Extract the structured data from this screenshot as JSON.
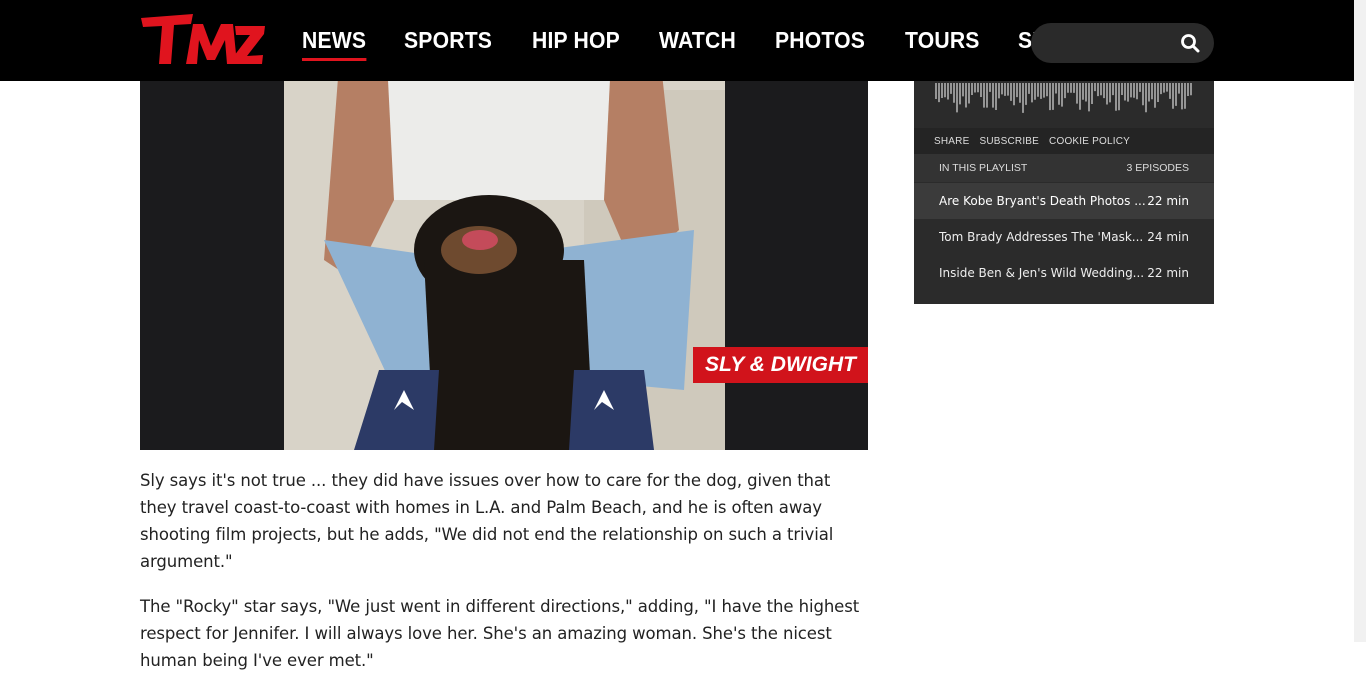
{
  "brand": {
    "logo_text": "TMZ",
    "accent": "#e0141e"
  },
  "nav": {
    "items": [
      {
        "label": "NEWS",
        "active": true
      },
      {
        "label": "SPORTS",
        "active": false
      },
      {
        "label": "HIP HOP",
        "active": false
      },
      {
        "label": "WATCH",
        "active": false
      },
      {
        "label": "PHOTOS",
        "active": false
      },
      {
        "label": "TOURS",
        "active": false
      },
      {
        "label": "SHOP",
        "active": false
      }
    ],
    "search": {
      "placeholder": "",
      "icon": "search-icon"
    }
  },
  "hero": {
    "caption_label": "SLY & DWIGHT"
  },
  "article": {
    "paragraphs": [
      "Sly says it's not true ... they did have issues over how to care for the dog, given that they travel coast-to-coast with homes in L.A. and Palm Beach, and he is often away shooting film projects, but he adds, \"We did not end the relationship on such a trivial argument.\"",
      "The \"Rocky\" star says, \"We just went in different directions,\" adding, \"I have the highest respect for Jennifer. I will always love her. She's an amazing woman. She's the nicest human being I've ever met.\""
    ]
  },
  "podcast": {
    "controls": {
      "share": "SHARE",
      "subscribe": "SUBSCRIBE",
      "cookie": "COOKIE POLICY"
    },
    "playlist": {
      "heading": "IN THIS PLAYLIST",
      "count": "3 EPISODES"
    },
    "episodes": [
      {
        "title": "Are Kobe Bryant's Death Photos ...",
        "duration": "22 min",
        "active": true
      },
      {
        "title": "Tom Brady Addresses The 'Mask...",
        "duration": "24 min",
        "active": false
      },
      {
        "title": "Inside Ben & Jen's Wild Wedding...",
        "duration": "22 min",
        "active": false
      }
    ]
  }
}
